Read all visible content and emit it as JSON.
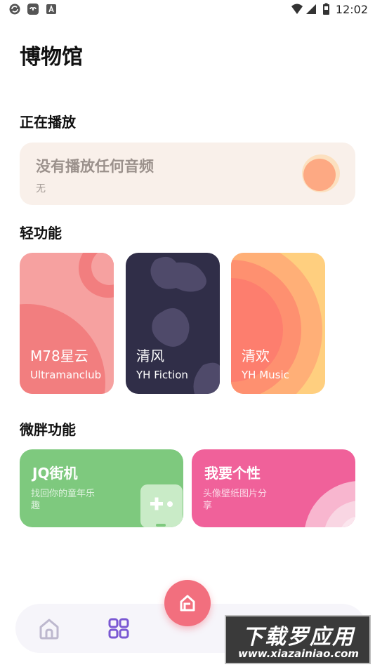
{
  "status_bar": {
    "time": "12:02",
    "icons": [
      "sync-icon",
      "cloud-app-icon",
      "font-app-icon",
      "wifi-icon",
      "signal-icon",
      "battery-icon"
    ]
  },
  "page": {
    "title": "博物馆"
  },
  "now_playing": {
    "section_title": "正在播放",
    "title": "没有播放任何音频",
    "subtitle": "无"
  },
  "lite_features": {
    "section_title": "轻功能",
    "cards": [
      {
        "name": "M78星云",
        "sub": "Ultramanclub"
      },
      {
        "name": "清风",
        "sub": "YH Fiction"
      },
      {
        "name": "清欢",
        "sub": "YH Music"
      }
    ]
  },
  "micro_features": {
    "section_title": "微胖功能",
    "cards": [
      {
        "title": "JQ街机",
        "desc": "找回你的童年乐趣"
      },
      {
        "title": "我要个性",
        "desc": "头像壁纸图片分享"
      }
    ]
  },
  "bottom_nav": {
    "items": [
      "home-icon",
      "grid-icon"
    ],
    "fab_icon": "museum-icon"
  },
  "watermark": {
    "main": "下载罗应用",
    "url": "www.xiazainiao.com"
  },
  "colors": {
    "accent": "#f26f7e",
    "now_playing_bg": "#f9f0ea",
    "card_pink": "#f6a1a0",
    "card_dark": "#302e48",
    "card_orange": "#ffcf7f",
    "card_green": "#7ec97e",
    "card_magenta": "#f0619a"
  }
}
